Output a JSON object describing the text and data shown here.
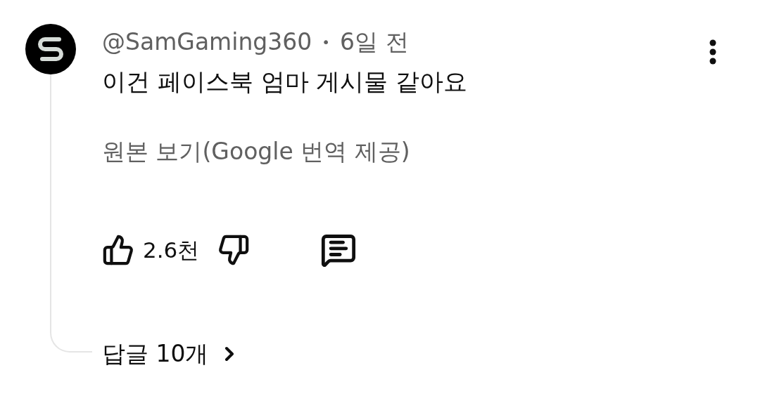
{
  "comment": {
    "author": "@SamGaming360",
    "separator": "•",
    "time": "6일 전",
    "text": "이건 페이스북 엄마 게시물 같아요",
    "translation_link": "원본 보기(Google 번역 제공)",
    "likes": "2.6천",
    "replies": "답글 10개"
  }
}
